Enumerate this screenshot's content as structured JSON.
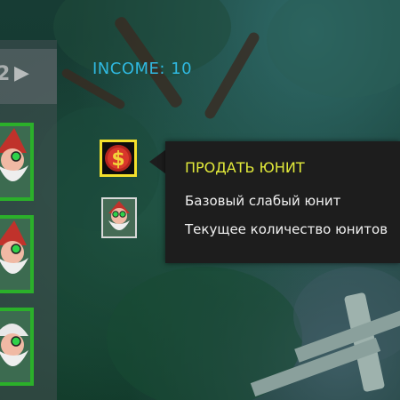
{
  "hud": {
    "income_label": "INCOME: 10",
    "pager_number": "2",
    "pager_arrow_glyph": "▶"
  },
  "unit_cards": [
    {
      "icon": "gnome-unit-icon",
      "hat": "#c0322b",
      "skin": "#f0b9a4",
      "beard": "#eeeeee"
    },
    {
      "icon": "gnome-unit-icon",
      "hat": "#c0322b",
      "skin": "#f0b9a4",
      "beard": "#eeeeee"
    },
    {
      "icon": "gnome-unit-icon",
      "hat": "#e8e8e8",
      "skin": "#f0b9a4",
      "beard": "#eeeeee"
    }
  ],
  "sell_slot": {
    "icon": "dollar-coin-icon",
    "border_color": "#f3e02c"
  },
  "unit_slot": {
    "icon": "gnome-unit-icon",
    "border_color": "#d9d9d9"
  },
  "tooltip": {
    "title": "ПРОДАТЬ ЮНИТ",
    "description": "Базовый слабый юнит",
    "count_text": "Текущее количество юнитов",
    "title_color": "#e2ea3a"
  },
  "colors": {
    "card_border": "#2bb02a",
    "income_text": "#2fb8e0"
  }
}
